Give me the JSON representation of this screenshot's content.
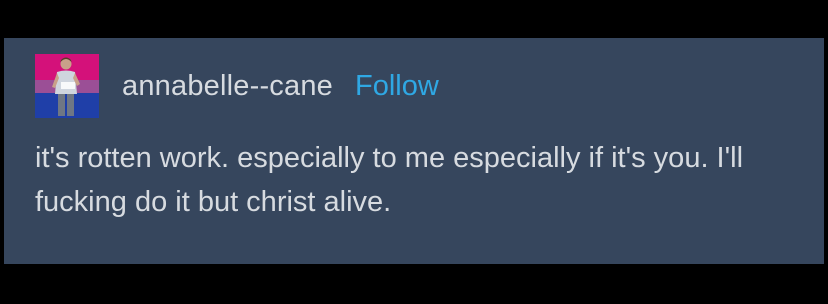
{
  "post": {
    "username": "annabelle--cane",
    "follow_label": "Follow",
    "text": "it's rotten work. especially to me especially if it's you. I'll fucking do it but christ alive."
  },
  "colors": {
    "page_background": "#000000",
    "post_background": "#36465d",
    "text": "#d7dbe0",
    "follow_link": "#2fa8e4",
    "avatar_flag_pink": "#d4117a",
    "avatar_flag_purple": "#9b4f96",
    "avatar_flag_blue": "#1f3fa8"
  },
  "icons": {
    "avatar": "avatar-person-on-bi-flag"
  }
}
